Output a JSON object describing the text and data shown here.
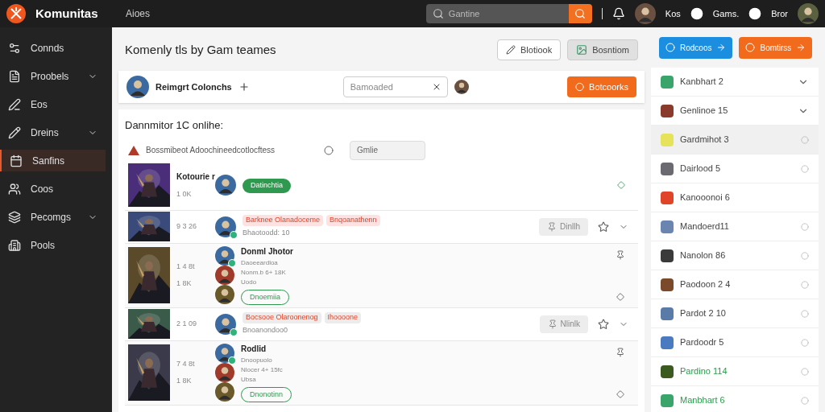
{
  "topbar": {
    "brand": "Komunitas",
    "nav_link": "Aioes",
    "search": {
      "placeholder": "Gantine"
    },
    "user_links": [
      "Kos",
      "Gams.",
      "Bror"
    ]
  },
  "sidebar": {
    "items": [
      {
        "label": "Connds",
        "has_submenu": false,
        "selected": false
      },
      {
        "label": "Proobels",
        "has_submenu": true,
        "selected": false
      },
      {
        "label": "Eos",
        "has_submenu": false,
        "selected": false
      },
      {
        "label": "Dreins",
        "has_submenu": true,
        "selected": false
      },
      {
        "label": "Sanfins",
        "has_submenu": false,
        "selected": true
      },
      {
        "label": "Coos",
        "has_submenu": false,
        "selected": false
      },
      {
        "label": "Pecomgs",
        "has_submenu": true,
        "selected": false
      },
      {
        "label": "Pools",
        "has_submenu": false,
        "selected": false
      }
    ]
  },
  "header": {
    "title": "Komenly tls by Gam teames",
    "buttons": [
      "Blotiook",
      "Bosntiom"
    ]
  },
  "profile_card": {
    "name": "Reimgrt Colonchs",
    "field": {
      "placeholder": "Bamoaded"
    },
    "action": "Botcoorks"
  },
  "section": {
    "title": "Dannmitor 1C onlihe:",
    "filter_text": "Bossmibeot Adoochineedcotlocftess",
    "filter_field": {
      "value": "Gmlie"
    }
  },
  "rows": [
    {
      "kind": "single",
      "title": "Kotourie r",
      "stats": [
        "1 0K"
      ],
      "badge": "Datinchtia"
    },
    {
      "kind": "tagged",
      "stats": [
        "9 3 26"
      ],
      "tags": [
        {
          "label": "Barknee Olanadoceme",
          "color": "#fde2e1"
        },
        {
          "label": "Bnqoanathenn",
          "color": "#fde2e1"
        }
      ],
      "subline": "Bhaotoodd: 10",
      "button": "Dinllh"
    },
    {
      "kind": "group",
      "title": "Donml Jhotor",
      "stats": [
        "1 4 8t",
        "1 8K"
      ],
      "lines": [
        "Daoeeardloa",
        "Nonm.b 6+ 18K",
        "Uodo"
      ],
      "badge": "Dnoemiia"
    },
    {
      "kind": "tagged",
      "stats": [
        "2 1 09"
      ],
      "tags": [
        {
          "label": "Bocsooe Olaroonenog",
          "color": "#ececec"
        },
        {
          "label": "Ihoooone",
          "color": "#ececec"
        }
      ],
      "subline": "Bnoanondoo0",
      "button": "Nlinlk"
    },
    {
      "kind": "group",
      "title": "Rodlid",
      "stats": [
        "7 4 8t",
        "1 8K"
      ],
      "lines": [
        "Dnoopuolo",
        "Nlocer 4+ 15fc",
        "Ubsa"
      ],
      "badge": "Dnonotinn"
    }
  ],
  "right_panel": {
    "buttons": [
      {
        "label": "Rodcoos",
        "color": "#1c8ee0"
      },
      {
        "label": "Bomtirss",
        "color": "#f26a1b"
      }
    ],
    "items": [
      {
        "label": "Kanbhart 2",
        "color": "#3aa56a",
        "kind": "chevron",
        "selected": false,
        "highlighted": false
      },
      {
        "label": "Genlinoe 15",
        "color": "#8a3a2a",
        "kind": "chevron",
        "selected": false,
        "highlighted": false
      },
      {
        "label": "Gardmihot 3",
        "color": "#e6e35a",
        "kind": "dot",
        "selected": true,
        "highlighted": false
      },
      {
        "label": "Dairlood 5",
        "color": "#6a6a70",
        "kind": "dot",
        "selected": false,
        "highlighted": false
      },
      {
        "label": "Kanooonoi 6",
        "color": "#e0452a",
        "kind": "plain",
        "selected": false,
        "highlighted": false
      },
      {
        "label": "Mandoerd11",
        "color": "#6a86b0",
        "kind": "dot",
        "selected": false,
        "highlighted": false
      },
      {
        "label": "Nanolon 86",
        "color": "#3a3a3a",
        "kind": "dot",
        "selected": false,
        "highlighted": false
      },
      {
        "label": "Paodoon 2 4",
        "color": "#7a4a2a",
        "kind": "dot",
        "selected": false,
        "highlighted": false
      },
      {
        "label": "Pardot 2 10",
        "color": "#5a7aa8",
        "kind": "dot",
        "selected": false,
        "highlighted": false
      },
      {
        "label": "Pardoodr 5",
        "color": "#4a7ac0",
        "kind": "dot",
        "selected": false,
        "highlighted": false
      },
      {
        "label": "Pardino 114",
        "color": "#3a5a20",
        "kind": "dot",
        "selected": false,
        "highlighted": true
      },
      {
        "label": "Manbhart 6",
        "color": "#3aa56a",
        "kind": "dot",
        "selected": false,
        "highlighted": true
      }
    ]
  }
}
